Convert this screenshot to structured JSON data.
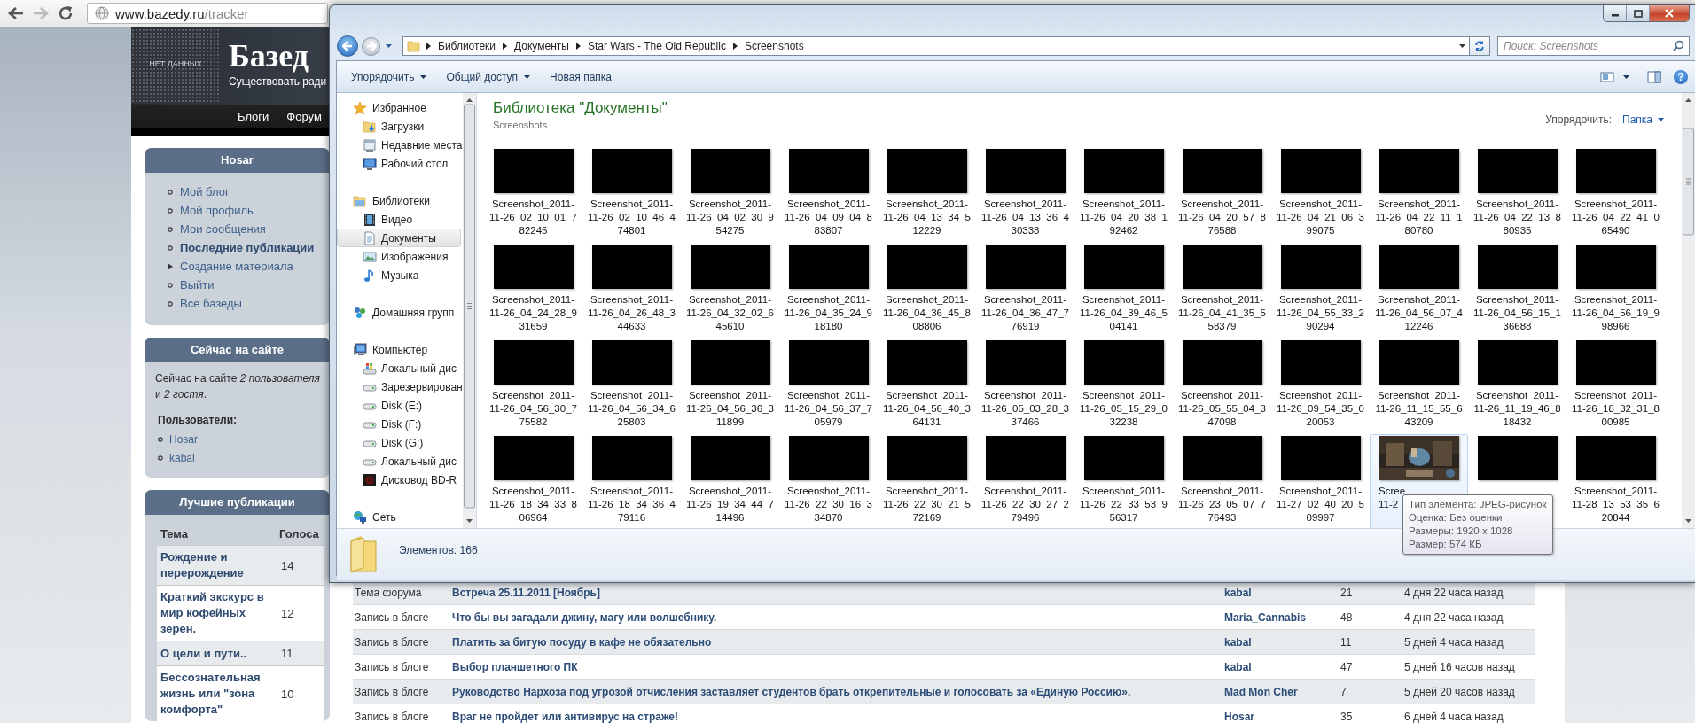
{
  "browser": {
    "url_host": "www.bazedy.ru",
    "url_path": "/tracker"
  },
  "site": {
    "logo_text": "НЕТ ДАННЫХ",
    "title": "Базед",
    "tagline": "Существовать ради",
    "nav": [
      "Блоги",
      "Форум"
    ],
    "user_menu": {
      "title": "Hosar",
      "items": [
        {
          "label": "Мой блог",
          "kind": "link",
          "selected": false
        },
        {
          "label": "Мой профиль",
          "kind": "link",
          "selected": false
        },
        {
          "label": "Мои сообщения",
          "kind": "link",
          "selected": false
        },
        {
          "label": "Последние публикации",
          "kind": "link",
          "selected": true
        },
        {
          "label": "Создание материала",
          "kind": "submenu",
          "selected": false
        },
        {
          "label": "Выйти",
          "kind": "link",
          "selected": false
        },
        {
          "label": "Все базеды",
          "kind": "link",
          "selected": false
        }
      ]
    },
    "online": {
      "title": "Сейчас на сайте",
      "summary": "Сейчас на сайте *2 пользователя*\nи *2 гостя*.",
      "users_label": "Пользователи:",
      "users": [
        "Hosar",
        "kabal"
      ]
    },
    "top_posts": {
      "title": "Лучшие публикации",
      "columns": [
        "Тема",
        "Голоса"
      ],
      "rows": [
        {
          "topic": "Рождение и перерождение",
          "votes": "14"
        },
        {
          "topic": "Краткий экскурс в мир кофейных зерен.",
          "votes": "12"
        },
        {
          "topic": "О цели и пути..",
          "votes": "11"
        },
        {
          "topic": "Бессознательная жизнь или \"зона комфорта\"",
          "votes": "10"
        }
      ]
    },
    "tracker": {
      "rows": [
        {
          "type": "Тема форума",
          "title": "Встреча 25.11.2011 [Ноябрь]",
          "author": "kabal",
          "replies": "21",
          "updated": "4 дня 22 часа назад"
        },
        {
          "type": "Запись в блоге",
          "title": "Что бы вы загадали джину, магу или волшебнику.",
          "author": "Maria_Cannabis",
          "replies": "48",
          "updated": "4 дня 22 часа назад"
        },
        {
          "type": "Запись в блоге",
          "title": "Платить за битую посуду в кафе не обязательно",
          "author": "kabal",
          "replies": "11",
          "updated": "5 дней 4 часа назад"
        },
        {
          "type": "Запись в блоге",
          "title": "Выбор планшетного ПК",
          "author": "kabal",
          "replies": "47",
          "updated": "5 дней 16 часов назад"
        },
        {
          "type": "Запись в блоге",
          "title": "Руководство Нархоза под угрозой отчисления заставляет студентов брать открепительные и голосовать за «Единую Россию».",
          "author": "Mad Mon Cher",
          "replies": "7",
          "updated": "5 дней 20 часов назад"
        },
        {
          "type": "Запись в блоге",
          "title": "Враг не пройдет или антивирус на страже!",
          "author": "Hosar",
          "replies": "35",
          "updated": "6 дней 4 часа назад"
        }
      ]
    }
  },
  "explorer": {
    "breadcrumb": [
      "Библиотеки",
      "Документы",
      "Star Wars - The Old Republic",
      "Screenshots"
    ],
    "search": {
      "placeholder": "Поиск: Screenshots"
    },
    "toolbar": [
      {
        "label": "Упорядочить",
        "dropdown": true
      },
      {
        "label": "Общий доступ",
        "dropdown": true
      },
      {
        "label": "Новая папка",
        "dropdown": false
      }
    ],
    "help_label": "?",
    "nav": [
      {
        "label": "Избранное",
        "kind": "favorites",
        "selected": false,
        "children": [
          {
            "label": "Загрузки",
            "kind": "downloads",
            "selected": false
          },
          {
            "label": "Недавние места",
            "kind": "recent",
            "selected": false
          },
          {
            "label": "Рабочий стол",
            "kind": "desktop",
            "selected": false
          }
        ]
      },
      {
        "label": "Библиотеки",
        "kind": "libraries",
        "selected": false,
        "children": [
          {
            "label": "Видео",
            "kind": "video",
            "selected": false
          },
          {
            "label": "Документы",
            "kind": "documents",
            "selected": true
          },
          {
            "label": "Изображения",
            "kind": "images",
            "selected": false
          },
          {
            "label": "Музыка",
            "kind": "music",
            "selected": false
          }
        ]
      },
      {
        "label": "Домашняя групп",
        "kind": "homegroup",
        "selected": false
      },
      {
        "label": "Компьютер",
        "kind": "computer",
        "selected": false,
        "children": [
          {
            "label": "Локальный дис",
            "kind": "system-drive",
            "selected": false
          },
          {
            "label": "Зарезервирован",
            "kind": "drive",
            "selected": false
          },
          {
            "label": "Disk (E:)",
            "kind": "drive",
            "selected": false
          },
          {
            "label": "Disk (F:)",
            "kind": "drive",
            "selected": false
          },
          {
            "label": "Disk (G:)",
            "kind": "drive",
            "selected": false
          },
          {
            "label": "Локальный дис",
            "kind": "drive",
            "selected": false
          },
          {
            "label": "Дисковод BD-R",
            "kind": "optical",
            "selected": false
          }
        ]
      },
      {
        "label": "Сеть",
        "kind": "network",
        "selected": false
      }
    ],
    "library_title": "Библиотека \"Документы\"",
    "library_subtitle": "Screenshots",
    "arrange_label": "Упорядочить:",
    "arrange_value": "Папка",
    "files": [
      {
        "kind": "tile",
        "hovered": false,
        "lines": [
          "Screenshot_2011-",
          "11-26_02_10_01_7",
          "82245"
        ]
      },
      {
        "kind": "tile",
        "hovered": false,
        "lines": [
          "Screenshot_2011-",
          "11-26_02_10_46_4",
          "74801"
        ]
      },
      {
        "kind": "tile",
        "hovered": false,
        "lines": [
          "Screenshot_2011-",
          "11-26_04_02_30_9",
          "54275"
        ]
      },
      {
        "kind": "tile",
        "hovered": false,
        "lines": [
          "Screenshot_2011-",
          "11-26_04_09_04_8",
          "83807"
        ]
      },
      {
        "kind": "tile",
        "hovered": false,
        "lines": [
          "Screenshot_2011-",
          "11-26_04_13_34_5",
          "12229"
        ]
      },
      {
        "kind": "tile",
        "hovered": false,
        "lines": [
          "Screenshot_2011-",
          "11-26_04_13_36_4",
          "30338"
        ]
      },
      {
        "kind": "tile",
        "hovered": false,
        "lines": [
          "Screenshot_2011-",
          "11-26_04_20_38_1",
          "92462"
        ]
      },
      {
        "kind": "tile",
        "hovered": false,
        "lines": [
          "Screenshot_2011-",
          "11-26_04_20_57_8",
          "76588"
        ]
      },
      {
        "kind": "tile",
        "hovered": false,
        "lines": [
          "Screenshot_2011-",
          "11-26_04_21_06_3",
          "99075"
        ]
      },
      {
        "kind": "tile",
        "hovered": false,
        "lines": [
          "Screenshot_2011-",
          "11-26_04_22_11_1",
          "80780"
        ]
      },
      {
        "kind": "tile",
        "hovered": false,
        "lines": [
          "Screenshot_2011-",
          "11-26_04_22_13_8",
          "80935"
        ]
      },
      {
        "kind": "tile",
        "hovered": false,
        "lines": [
          "Screenshot_2011-",
          "11-26_04_22_41_0",
          "65490"
        ]
      },
      {
        "kind": "tile",
        "hovered": false,
        "lines": [
          "Screenshot_2011-",
          "11-26_04_24_28_9",
          "31659"
        ]
      },
      {
        "kind": "tile",
        "hovered": false,
        "lines": [
          "Screenshot_2011-",
          "11-26_04_26_48_3",
          "44633"
        ]
      },
      {
        "kind": "tile",
        "hovered": false,
        "lines": [
          "Screenshot_2011-",
          "11-26_04_32_02_6",
          "45610"
        ]
      },
      {
        "kind": "tile",
        "hovered": false,
        "lines": [
          "Screenshot_2011-",
          "11-26_04_35_24_9",
          "18180"
        ]
      },
      {
        "kind": "tile",
        "hovered": false,
        "lines": [
          "Screenshot_2011-",
          "11-26_04_36_45_8",
          "08806"
        ]
      },
      {
        "kind": "tile",
        "hovered": false,
        "lines": [
          "Screenshot_2011-",
          "11-26_04_36_47_7",
          "76919"
        ]
      },
      {
        "kind": "tile",
        "hovered": false,
        "lines": [
          "Screenshot_2011-",
          "11-26_04_39_46_5",
          "04141"
        ]
      },
      {
        "kind": "tile",
        "hovered": false,
        "lines": [
          "Screenshot_2011-",
          "11-26_04_41_35_5",
          "58379"
        ]
      },
      {
        "kind": "tile",
        "hovered": false,
        "lines": [
          "Screenshot_2011-",
          "11-26_04_55_33_2",
          "90294"
        ]
      },
      {
        "kind": "tile",
        "hovered": false,
        "lines": [
          "Screenshot_2011-",
          "11-26_04_56_07_4",
          "12246"
        ]
      },
      {
        "kind": "tile",
        "hovered": false,
        "lines": [
          "Screenshot_2011-",
          "11-26_04_56_15_1",
          "36688"
        ]
      },
      {
        "kind": "tile",
        "hovered": false,
        "lines": [
          "Screenshot_2011-",
          "11-26_04_56_19_9",
          "98966"
        ]
      },
      {
        "kind": "tile",
        "hovered": false,
        "lines": [
          "Screenshot_2011-",
          "11-26_04_56_30_7",
          "75582"
        ]
      },
      {
        "kind": "tile",
        "hovered": false,
        "lines": [
          "Screenshot_2011-",
          "11-26_04_56_34_6",
          "25803"
        ]
      },
      {
        "kind": "tile",
        "hovered": false,
        "lines": [
          "Screenshot_2011-",
          "11-26_04_56_36_3",
          "11899"
        ]
      },
      {
        "kind": "tile",
        "hovered": false,
        "lines": [
          "Screenshot_2011-",
          "11-26_04_56_37_7",
          "05979"
        ]
      },
      {
        "kind": "tile",
        "hovered": false,
        "lines": [
          "Screenshot_2011-",
          "11-26_04_56_40_3",
          "64131"
        ]
      },
      {
        "kind": "tile",
        "hovered": false,
        "lines": [
          "Screenshot_2011-",
          "11-26_05_03_28_3",
          "37466"
        ]
      },
      {
        "kind": "tile",
        "hovered": false,
        "lines": [
          "Screenshot_2011-",
          "11-26_05_15_29_0",
          "32238"
        ]
      },
      {
        "kind": "tile",
        "hovered": false,
        "lines": [
          "Screenshot_2011-",
          "11-26_05_55_04_3",
          "47098"
        ]
      },
      {
        "kind": "tile",
        "hovered": false,
        "lines": [
          "Screenshot_2011-",
          "11-26_09_54_35_0",
          "20053"
        ]
      },
      {
        "kind": "tile",
        "hovered": false,
        "lines": [
          "Screenshot_2011-",
          "11-26_11_15_55_6",
          "43209"
        ]
      },
      {
        "kind": "tile",
        "hovered": false,
        "lines": [
          "Screenshot_2011-",
          "11-26_11_19_46_8",
          "18432"
        ]
      },
      {
        "kind": "tile",
        "hovered": false,
        "lines": [
          "Screenshot_2011-",
          "11-26_18_32_31_8",
          "00985"
        ]
      },
      {
        "kind": "tile",
        "hovered": false,
        "lines": [
          "Screenshot_2011-",
          "11-26_18_34_33_8",
          "06964"
        ]
      },
      {
        "kind": "tile",
        "hovered": false,
        "lines": [
          "Screenshot_2011-",
          "11-26_18_34_36_4",
          "79116"
        ]
      },
      {
        "kind": "tile",
        "hovered": false,
        "lines": [
          "Screenshot_2011-",
          "11-26_19_34_44_7",
          "14496"
        ]
      },
      {
        "kind": "tile",
        "hovered": false,
        "lines": [
          "Screenshot_2011-",
          "11-26_22_30_16_3",
          "34870"
        ]
      },
      {
        "kind": "tile",
        "hovered": false,
        "lines": [
          "Screenshot_2011-",
          "11-26_22_30_21_5",
          "72169"
        ]
      },
      {
        "kind": "tile",
        "hovered": false,
        "lines": [
          "Screenshot_2011-",
          "11-26_22_30_27_2",
          "79496"
        ]
      },
      {
        "kind": "tile",
        "hovered": false,
        "lines": [
          "Screenshot_2011-",
          "11-26_22_33_53_9",
          "56317"
        ]
      },
      {
        "kind": "tile",
        "hovered": false,
        "lines": [
          "Screenshot_2011-",
          "11-26_23_05_07_7",
          "76493"
        ]
      },
      {
        "kind": "tile",
        "hovered": false,
        "lines": [
          "Screenshot_2011-",
          "11-27_02_40_20_5",
          "09997"
        ]
      },
      {
        "kind": "picture-tile",
        "hovered": true,
        "lines": [
          "Scree",
          "11-2"
        ]
      },
      {
        "kind": "covered-tile",
        "hovered": false
      },
      {
        "kind": "tile",
        "hovered": false,
        "lines": [
          "Screenshot_2011-",
          "11-28_13_53_35_6",
          "20844"
        ]
      }
    ],
    "tooltip": [
      "Тип элемента: JPEG-рисунок",
      "Оценка: Без оценки",
      "Размеры: 1920 x 1028",
      "Размер: 574 КБ"
    ],
    "status": "Элементов: 166"
  }
}
